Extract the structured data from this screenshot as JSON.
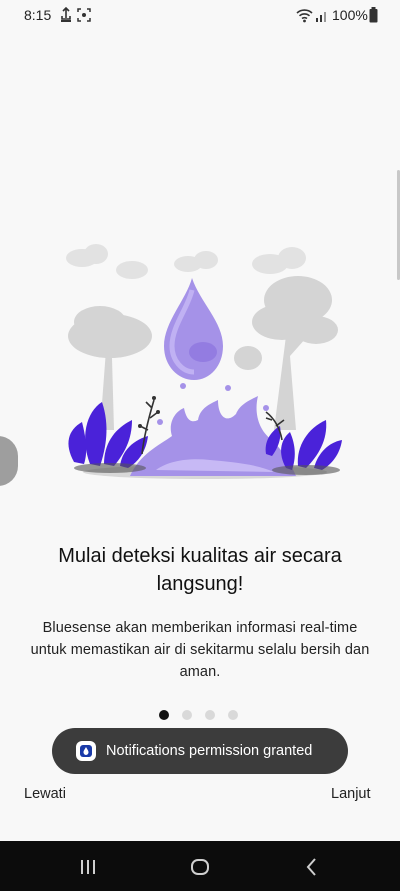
{
  "status_bar": {
    "time": "8:15",
    "battery": "100%",
    "icons": [
      "usb-debug-icon",
      "screenshot-icon",
      "wifi-icon",
      "signal-icon",
      "battery-icon"
    ]
  },
  "onboarding": {
    "title": "Mulai deteksi kualitas air secara langsung!",
    "description": "Bluesense akan memberikan informasi real-time untuk memastikan air di sekitarmu selalu bersih dan aman.",
    "page_indicator": {
      "current": 1,
      "total": 4
    },
    "illustration": "water-drop-splash-illustration",
    "accent_color": "#5b2ad6"
  },
  "toast": {
    "text": "Notifications permission granted",
    "icon": "app-icon"
  },
  "actions": {
    "skip_label": "Lewati",
    "next_label": "Lanjut"
  },
  "system_nav": {
    "buttons": [
      "recents-button",
      "home-button",
      "back-button"
    ]
  }
}
